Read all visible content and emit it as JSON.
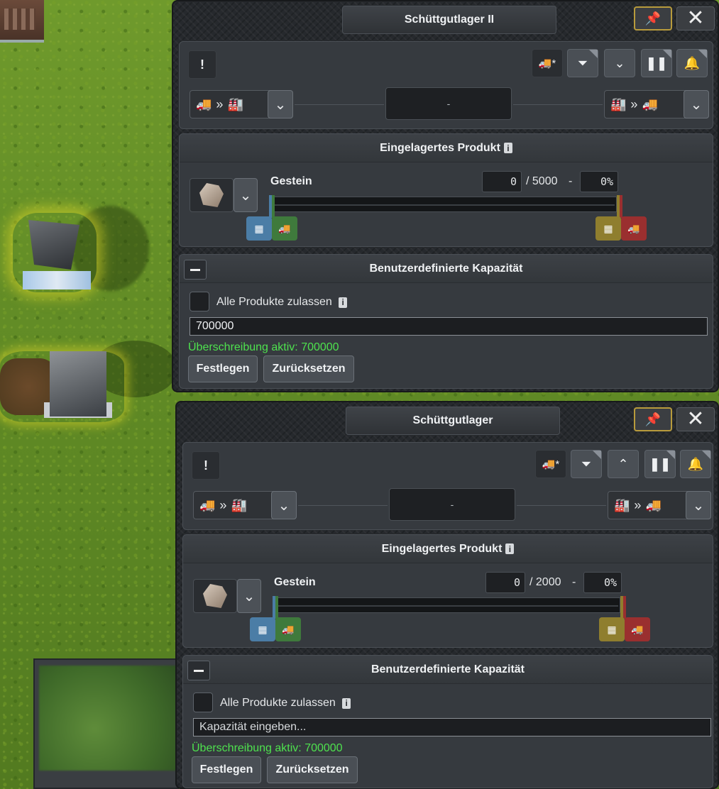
{
  "colors": {
    "accent_pin": "#b89b3c",
    "progress_fill": "#8fd14f",
    "override_text": "#4ee24e",
    "chip_blue": "#4b7da6",
    "chip_green": "#3f7a3c",
    "chip_yellow": "#8f7e2e",
    "chip_red": "#9a2f2f"
  },
  "panels": [
    {
      "title": "Schüttgutlager II",
      "center_value": "-",
      "product_section_title": "Eingelagertes Produkt",
      "product_name": "Gestein",
      "stored_amount": "0",
      "capacity_text": "/ 5000",
      "dash": "-",
      "percent": "0%",
      "fill_fraction": 0,
      "buffer_button_icon": "chevrons-down-icon",
      "capacity_section_title": "Benutzerdefinierte Kapazität",
      "allow_all_label": "Alle Produkte zulassen",
      "capacity_input_value": "700000",
      "capacity_input_placeholder": "Kapazität eingeben...",
      "override_text": "Überschreibung aktiv: 700000",
      "set_button": "Festlegen",
      "reset_button": "Zurücksetzen"
    },
    {
      "title": "Schüttgutlager",
      "center_value": "-",
      "product_section_title": "Eingelagertes Produkt",
      "product_name": "Gestein",
      "stored_amount": "0",
      "capacity_text": "/ 2000",
      "dash": "-",
      "percent": "0%",
      "fill_fraction": 0,
      "buffer_button_icon": "chevrons-up-icon",
      "capacity_section_title": "Benutzerdefinierte Kapazität",
      "allow_all_label": "Alle Produkte zulassen",
      "capacity_input_value": "",
      "capacity_input_placeholder": "Kapazität eingeben...",
      "override_text": "Überschreibung aktiv: 700000",
      "set_button": "Festlegen",
      "reset_button": "Zurücksetzen"
    }
  ]
}
